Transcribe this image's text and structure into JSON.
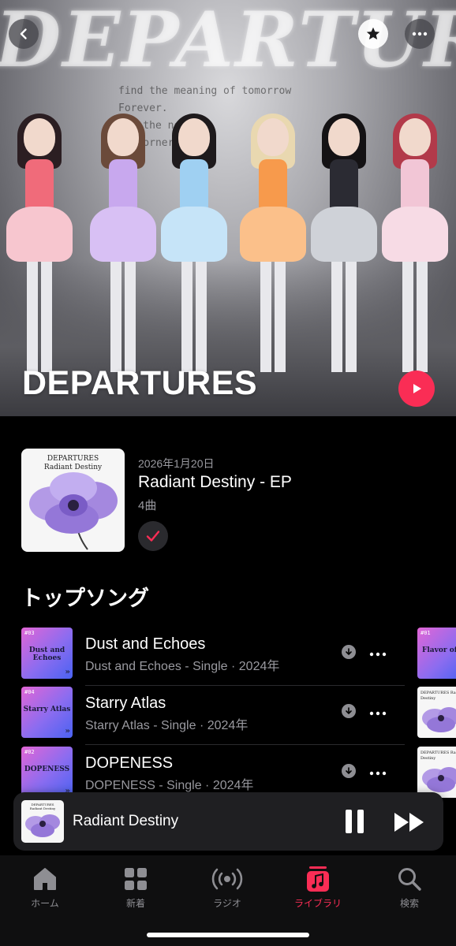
{
  "header": {
    "back_icon": "chevron-left-icon",
    "favorite_icon": "star-icon",
    "more_icon": "ellipsis-icon"
  },
  "hero": {
    "logo_text": "DEPARTURES",
    "artist_name": "DEPARTURES",
    "lyrics_lines": [
      "find the meaning of tomorrow",
      "Forever.",
      "I w   the neon",
      "of   corner"
    ],
    "play_icon": "play-icon",
    "accent_color": "#fa2d55"
  },
  "latest_release": {
    "art_artist": "DEPARTURES",
    "art_title": "Radiant Destiny",
    "date": "2026年1月20日",
    "title": "Radiant Destiny - EP",
    "track_count": "4曲",
    "added_icon": "checkmark-icon"
  },
  "top_songs": {
    "heading": "トップソング",
    "items": [
      {
        "title": "Dust and Echoes",
        "subtitle": "Dust and Echoes - Single · 2024年",
        "art_label": "Dust and Echoes",
        "art_num": "#03"
      },
      {
        "title": "Starry Atlas",
        "subtitle": "Starry Atlas - Single · 2024年",
        "art_label": "Starry Atlas",
        "art_num": "#04"
      },
      {
        "title": "DOPENESS",
        "subtitle": "DOPENESS - Single · 2024年",
        "art_label": "DOPENESS",
        "art_num": "#02"
      }
    ],
    "peek_items": [
      {
        "art_label": "Flavor of s",
        "art_num": "#01"
      },
      {
        "art_label": "DEPARTURES Radiant Destiny"
      },
      {
        "art_label": "DEPARTURES Radiant Destiny"
      }
    ]
  },
  "now_playing": {
    "title": "Radiant Destiny",
    "art_artist": "DEPARTURES",
    "art_title": "Radiant Destiny",
    "pause_icon": "pause-icon",
    "next_icon": "forward-icon"
  },
  "tabbar": {
    "tabs": [
      {
        "label": "ホーム",
        "icon": "home-icon",
        "active": false
      },
      {
        "label": "新着",
        "icon": "grid-icon",
        "active": false
      },
      {
        "label": "ラジオ",
        "icon": "radio-icon",
        "active": false
      },
      {
        "label": "ライブラリ",
        "icon": "music-library-icon",
        "active": true
      },
      {
        "label": "検索",
        "icon": "search-icon",
        "active": false
      }
    ]
  }
}
